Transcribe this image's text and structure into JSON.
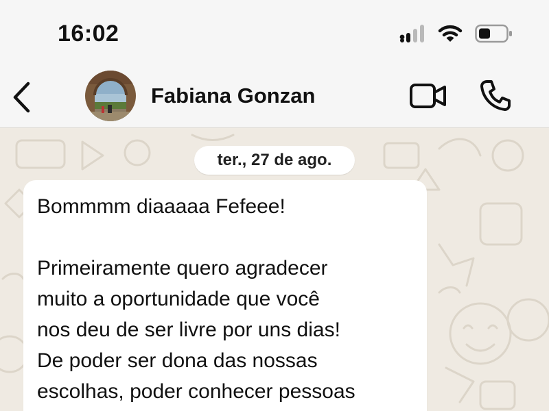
{
  "status_bar": {
    "time": "16:02",
    "icons": [
      "cellular-signal-icon",
      "wifi-icon",
      "battery-icon"
    ]
  },
  "header": {
    "contact_name": "Fabiana Gonzan",
    "back_icon": "chevron-left-icon",
    "actions": [
      {
        "icon": "video-camera-icon"
      },
      {
        "icon": "phone-icon"
      }
    ]
  },
  "chat": {
    "date_separator": "ter., 27 de ago.",
    "messages": [
      {
        "lines": [
          "Bommmm diaaaaa Fefeee!",
          "",
          "Primeiramente quero agradecer",
          "muito a oportunidade que você",
          "nos deu de ser livre por uns dias!",
          "De poder ser dona das nossas",
          "escolhas, poder conhecer pessoas"
        ]
      }
    ]
  },
  "colors": {
    "header_bg": "#f6f6f6",
    "chat_bg": "#efeae2",
    "bubble_bg": "#ffffff",
    "text": "#111111"
  }
}
